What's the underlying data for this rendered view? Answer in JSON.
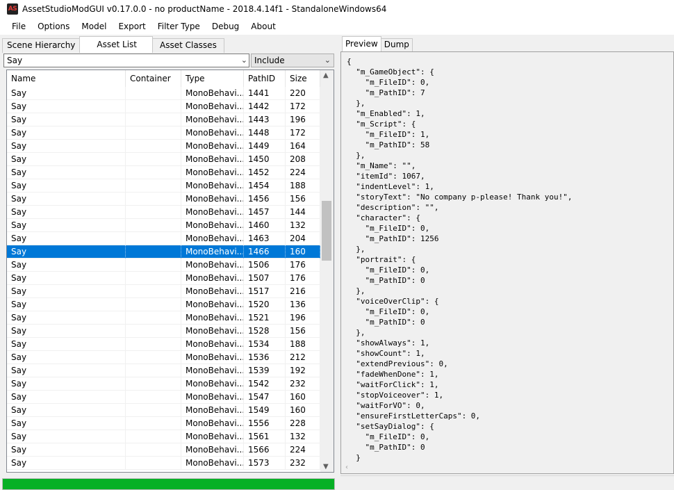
{
  "window": {
    "app_icon": "AS",
    "title": "AssetStudioModGUI v0.17.0.0 - no productName - 2018.4.14f1 - StandaloneWindows64"
  },
  "menu": [
    "File",
    "Options",
    "Model",
    "Export",
    "Filter Type",
    "Debug",
    "About"
  ],
  "left_tabs": [
    {
      "label": "Scene Hierarchy",
      "active": false
    },
    {
      "label": "Asset List",
      "active": true
    },
    {
      "label": "Asset Classes",
      "active": false
    }
  ],
  "filter": {
    "search_value": "Say",
    "mode_value": "Include"
  },
  "table": {
    "headers": [
      "Name",
      "Container",
      "Type",
      "PathID",
      "Size"
    ],
    "selected_index": 12,
    "rows": [
      [
        "Say",
        "",
        "MonoBehavi...",
        "1441",
        "220"
      ],
      [
        "Say",
        "",
        "MonoBehavi...",
        "1442",
        "172"
      ],
      [
        "Say",
        "",
        "MonoBehavi...",
        "1443",
        "196"
      ],
      [
        "Say",
        "",
        "MonoBehavi...",
        "1448",
        "172"
      ],
      [
        "Say",
        "",
        "MonoBehavi...",
        "1449",
        "164"
      ],
      [
        "Say",
        "",
        "MonoBehavi...",
        "1450",
        "208"
      ],
      [
        "Say",
        "",
        "MonoBehavi...",
        "1452",
        "224"
      ],
      [
        "Say",
        "",
        "MonoBehavi...",
        "1454",
        "188"
      ],
      [
        "Say",
        "",
        "MonoBehavi...",
        "1456",
        "156"
      ],
      [
        "Say",
        "",
        "MonoBehavi...",
        "1457",
        "144"
      ],
      [
        "Say",
        "",
        "MonoBehavi...",
        "1460",
        "132"
      ],
      [
        "Say",
        "",
        "MonoBehavi...",
        "1463",
        "204"
      ],
      [
        "Say",
        "",
        "MonoBehavi...",
        "1466",
        "160"
      ],
      [
        "Say",
        "",
        "MonoBehavi...",
        "1506",
        "176"
      ],
      [
        "Say",
        "",
        "MonoBehavi...",
        "1507",
        "176"
      ],
      [
        "Say",
        "",
        "MonoBehavi...",
        "1517",
        "216"
      ],
      [
        "Say",
        "",
        "MonoBehavi...",
        "1520",
        "136"
      ],
      [
        "Say",
        "",
        "MonoBehavi...",
        "1521",
        "196"
      ],
      [
        "Say",
        "",
        "MonoBehavi...",
        "1528",
        "156"
      ],
      [
        "Say",
        "",
        "MonoBehavi...",
        "1534",
        "188"
      ],
      [
        "Say",
        "",
        "MonoBehavi...",
        "1536",
        "212"
      ],
      [
        "Say",
        "",
        "MonoBehavi...",
        "1539",
        "192"
      ],
      [
        "Say",
        "",
        "MonoBehavi...",
        "1542",
        "232"
      ],
      [
        "Say",
        "",
        "MonoBehavi...",
        "1547",
        "160"
      ],
      [
        "Say",
        "",
        "MonoBehavi...",
        "1549",
        "160"
      ],
      [
        "Say",
        "",
        "MonoBehavi...",
        "1556",
        "228"
      ],
      [
        "Say",
        "",
        "MonoBehavi...",
        "1561",
        "132"
      ],
      [
        "Say",
        "",
        "MonoBehavi...",
        "1566",
        "224"
      ],
      [
        "Say",
        "",
        "MonoBehavi...",
        "1573",
        "232"
      ]
    ]
  },
  "progress": {
    "fraction": 1.0,
    "color": "#06b025"
  },
  "right_tabs": [
    {
      "label": "Preview",
      "active": true
    },
    {
      "label": "Dump",
      "active": false
    }
  ],
  "preview_lines": [
    "{",
    "  \"m_GameObject\": {",
    "    \"m_FileID\": 0,",
    "    \"m_PathID\": 7",
    "  },",
    "  \"m_Enabled\": 1,",
    "  \"m_Script\": {",
    "    \"m_FileID\": 1,",
    "    \"m_PathID\": 58",
    "  },",
    "  \"m_Name\": \"\",",
    "  \"itemId\": 1067,",
    "  \"indentLevel\": 1,",
    "  \"storyText\": \"No company p-please! Thank you!\",",
    "  \"description\": \"\",",
    "  \"character\": {",
    "    \"m_FileID\": 0,",
    "    \"m_PathID\": 1256",
    "  },",
    "  \"portrait\": {",
    "    \"m_FileID\": 0,",
    "    \"m_PathID\": 0",
    "  },",
    "  \"voiceOverClip\": {",
    "    \"m_FileID\": 0,",
    "    \"m_PathID\": 0",
    "  },",
    "  \"showAlways\": 1,",
    "  \"showCount\": 1,",
    "  \"extendPrevious\": 0,",
    "  \"fadeWhenDone\": 1,",
    "  \"waitForClick\": 1,",
    "  \"stopVoiceover\": 1,",
    "  \"waitForVO\": 0,",
    "  \"ensureFirstLetterCaps\": 0,",
    "  \"setSayDialog\": {",
    "    \"m_FileID\": 0,",
    "    \"m_PathID\": 0",
    "  }"
  ],
  "colors": {
    "selection": "#0078d7",
    "progress": "#06b025"
  }
}
